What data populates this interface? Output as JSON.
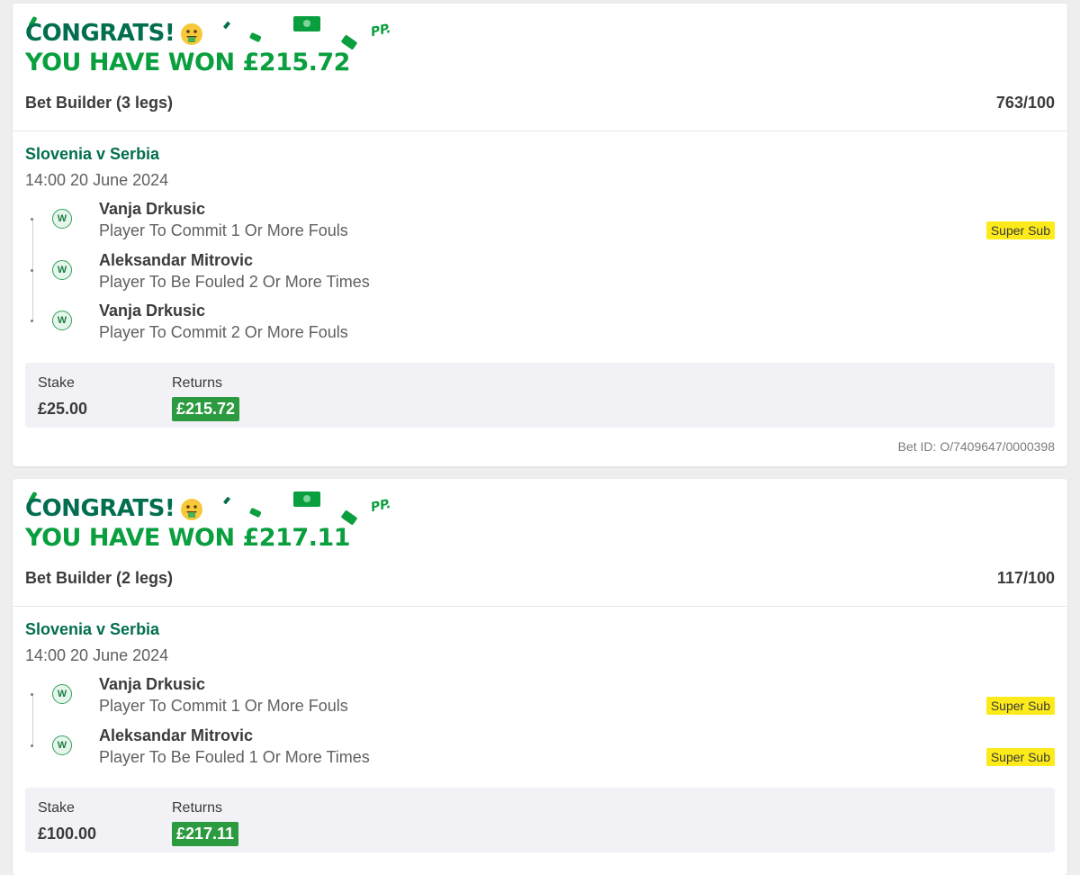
{
  "bets": [
    {
      "banner": {
        "congrats": "CONGRATS!",
        "won": "YOU HAVE WON £215.72",
        "pp": "PP."
      },
      "title": "Bet Builder (3 legs)",
      "odds": "763/100",
      "event": {
        "name": "Slovenia v Serbia",
        "date": "14:00 20 June 2024"
      },
      "legs": [
        {
          "player": "Vanja Drkusic",
          "market": "Player To Commit 1 Or More Fouls",
          "status": "W",
          "badge": "Super Sub"
        },
        {
          "player": "Aleksandar Mitrovic",
          "market": "Player To Be Fouled 2 Or More Times",
          "status": "W",
          "badge": ""
        },
        {
          "player": "Vanja Drkusic",
          "market": "Player To Commit 2 Or More Fouls",
          "status": "W",
          "badge": ""
        }
      ],
      "stake_label": "Stake",
      "stake": "£25.00",
      "returns_label": "Returns",
      "returns": "£215.72",
      "bet_id": "Bet ID: O/7409647/0000398"
    },
    {
      "banner": {
        "congrats": "CONGRATS!",
        "won": "YOU HAVE WON £217.11",
        "pp": "PP."
      },
      "title": "Bet Builder (2 legs)",
      "odds": "117/100",
      "event": {
        "name": "Slovenia v Serbia",
        "date": "14:00 20 June 2024"
      },
      "legs": [
        {
          "player": "Vanja Drkusic",
          "market": "Player To Commit 1 Or More Fouls",
          "status": "W",
          "badge": "Super Sub"
        },
        {
          "player": "Aleksandar Mitrovic",
          "market": "Player To Be Fouled 1 Or More Times",
          "status": "W",
          "badge": "Super Sub"
        }
      ],
      "stake_label": "Stake",
      "stake": "£100.00",
      "returns_label": "Returns",
      "returns": "£217.11"
    }
  ],
  "colors": {
    "brand_dark": "#026e50",
    "brand_green": "#0a9f3e",
    "returns_bg": "#2c9a3f",
    "super_sub_bg": "#fcea1a"
  },
  "icons": {
    "win": "win-check-icon",
    "emoji": "money-mouth-face-icon",
    "confetti": "money-confetti-icon"
  }
}
